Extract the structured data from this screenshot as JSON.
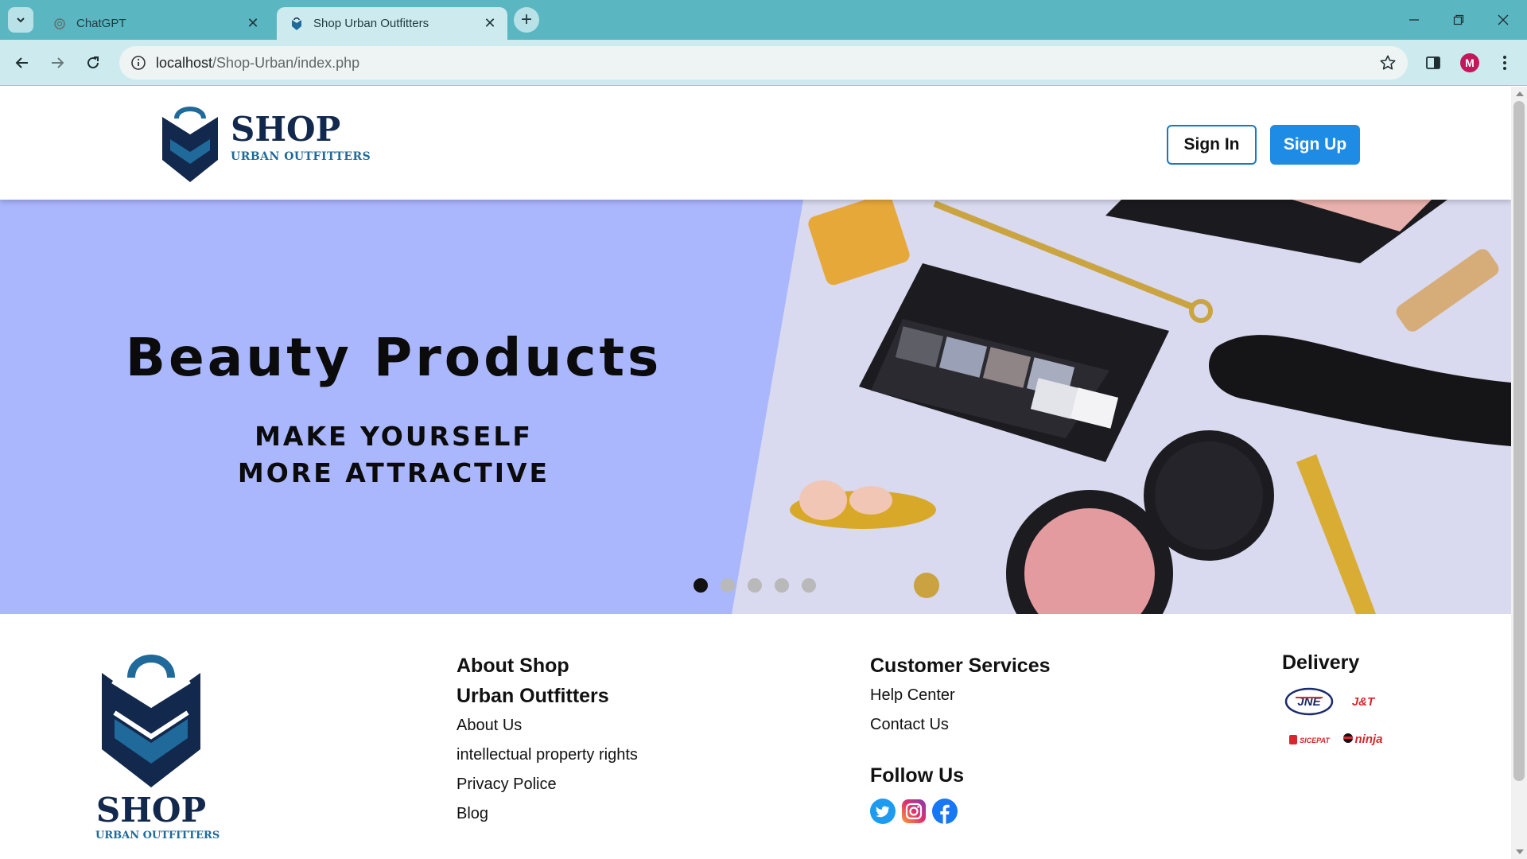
{
  "browser": {
    "tabs": [
      {
        "title": "ChatGPT",
        "icon": "chatgpt-icon",
        "active": false
      },
      {
        "title": "Shop Urban Outfitters",
        "icon": "shop-favicon-icon",
        "active": true
      }
    ],
    "address": {
      "host": "localhost",
      "path": "/Shop-Urban/index.php"
    },
    "profile_initial": "M",
    "colors": {
      "tabstrip": "#5ab6c1",
      "toolbar": "#cdebee",
      "profile": "#c2185b"
    }
  },
  "header": {
    "logo": {
      "shop": "SHOP",
      "sub": "URBAN OUTFITTERS"
    },
    "signin_label": "Sign In",
    "signup_label": "Sign Up",
    "colors": {
      "brand_navy": "#12284d",
      "brand_blue": "#1f6a9a",
      "signup_bg": "#1e8ce4"
    }
  },
  "hero": {
    "title": "Beauty Products",
    "subtitle_line1": "MAKE YOURSELF",
    "subtitle_line2": "MORE ATTRACTIVE",
    "slide_count": 5,
    "active_slide": 1,
    "colors": {
      "panel": "#aab7fd",
      "photo_bg": "#d9d9ef"
    }
  },
  "footer": {
    "logo": {
      "shop": "SHOP",
      "sub": "URBAN OUTFITTERS"
    },
    "about": {
      "heading_line1": "About Shop",
      "heading_line2": "Urban Outfitters",
      "links": [
        "About Us",
        "intellectual property rights",
        "Privacy Police",
        "Blog"
      ]
    },
    "services": {
      "heading": "Customer Services",
      "links": [
        "Help Center",
        "Contact Us"
      ]
    },
    "follow": {
      "heading": "Follow Us",
      "icons": [
        "twitter-icon",
        "instagram-icon",
        "facebook-icon"
      ]
    },
    "delivery": {
      "heading": "Delivery",
      "logos": [
        "JNE",
        "J&T",
        "SICEPAT",
        "ninja"
      ]
    }
  }
}
